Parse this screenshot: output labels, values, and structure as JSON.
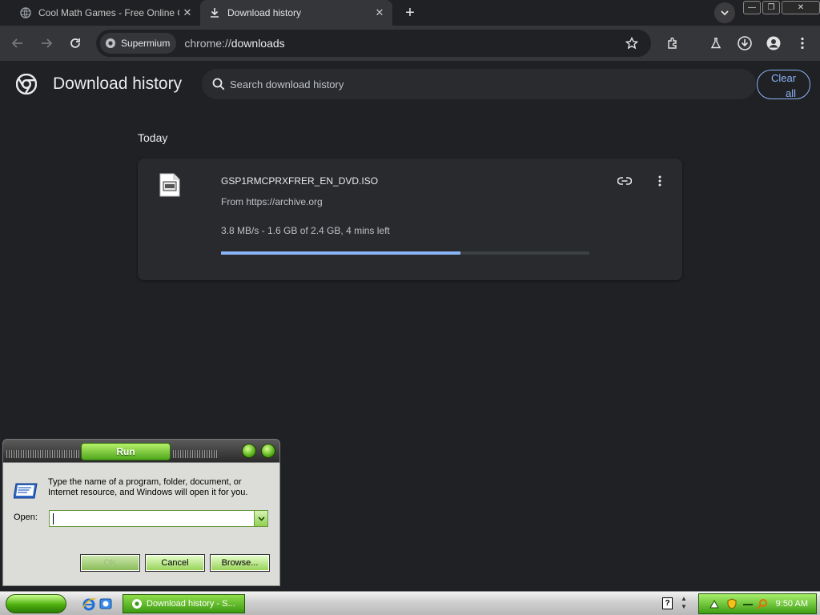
{
  "browser": {
    "tabs": [
      {
        "title": "Cool Math Games - Free Online Ga",
        "favicon": "globe-icon",
        "active": false
      },
      {
        "title": "Download history",
        "favicon": "download-icon",
        "active": true
      }
    ],
    "profile_chip": "Supermium",
    "url_scheme": "chrome://",
    "url_host": "downloads"
  },
  "page": {
    "title": "Download history",
    "search_placeholder": "Search download history",
    "clear_all_line1": "Clear",
    "clear_all_line2": "all",
    "section": "Today",
    "download": {
      "filename": "GSP1RMCPRXFRER_EN_DVD.ISO",
      "source": "From https://archive.org",
      "status": "3.8 MB/s - 1.6 GB of 2.4 GB, 4 mins left",
      "progress_fraction": 0.65
    }
  },
  "run_dialog": {
    "title": "Run",
    "description": "Type the name of a program, folder, document, or Internet resource, and Windows will open it for you.",
    "open_label": "Open:",
    "open_value": "",
    "ok_label": "OK",
    "cancel_label": "Cancel",
    "browse_label": "Browse..."
  },
  "taskbar": {
    "task_label": "Download history - S...",
    "clock": "9:50 AM"
  },
  "colors": {
    "accent": "#8ab4f8",
    "background": "#202124",
    "card": "#292a2d",
    "xp_green": "#4fa61c"
  }
}
